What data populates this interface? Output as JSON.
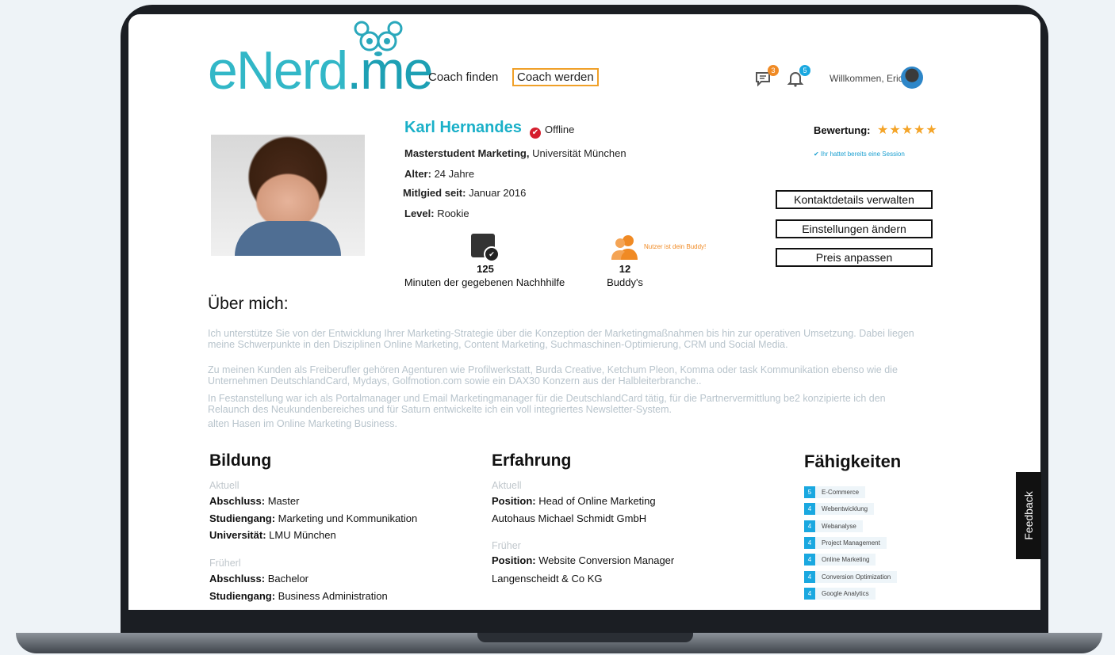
{
  "header": {
    "logo_main": "eNerd",
    "logo_dot": ".me",
    "nav_find": "Coach finden",
    "nav_become": "Coach werden",
    "messages_badge": "3",
    "notifications_badge": "5",
    "welcome": "Willkommen, Eric"
  },
  "profile": {
    "name": "Karl Hernandes",
    "status": "Offline",
    "degree_bold": "Masterstudent Marketing,",
    "degree_rest": " Universität München",
    "age_label": "Alter:",
    "age_value": " 24 Jahre",
    "member_label": "Mitlgied seit:",
    "member_value": " Januar 2016",
    "level_label": "Level:",
    "level_value": " Rookie",
    "stat_minutes_num": "125",
    "stat_minutes_label": "Minuten der gegebenen Nachhhilfe",
    "stat_buddies_num": "12",
    "stat_buddies_label": "Buddy's",
    "buddy_note": "Nutzer ist dein Buddy!",
    "rating_label": "Bewertung:",
    "rating_stars": 5,
    "session_note": "✔ Ihr hattet bereits eine Session",
    "btn_contact": "Kontaktdetails verwalten",
    "btn_settings": "Einstellungen ändern",
    "btn_price": "Preis anpassen"
  },
  "about": {
    "heading": "Über mich:",
    "p1": "Ich unterstütze Sie von der Entwicklung Ihrer Marketing-Strategie über die Konzeption der Marketingmaßnahmen bis hin zur operativen Umsetzung. Dabei liegen meine Schwerpunkte in den Disziplinen Online Marketing, Content Marketing, Suchmaschinen-Optimierung, CRM und Social Media.",
    "p2": "Zu meinen Kunden als Freiberufler gehören Agenturen wie Profilwerkstatt, Burda Creative, Ketchum Pleon, Komma oder task Kommunikation ebenso wie die Unternehmen DeutschlandCard, Mydays, Golfmotion.com sowie ein DAX30 Konzern aus der Halbleiterbranche..",
    "p3": "In Festanstellung war ich als Portalmanager und Email Marketingmanager für die DeutschlandCard tätig, für die Partnervermittlung be2 konzipierte ich den Relaunch des Neukundenbereiches und für Saturn entwickelte ich ein voll integriertes Newsletter-System.",
    "p4": "alten Hasen im Online Marketing Business."
  },
  "education": {
    "heading": "Bildung",
    "current_label": "Aktuell",
    "c_degree_label": "Abschluss:",
    "c_degree": " Master",
    "c_course_label": "Studiengang:",
    "c_course": " Marketing und Kommunikation",
    "c_uni_label": "Universität:",
    "c_uni": " LMU München",
    "prev_label": "Früherl",
    "p_degree_label": "Abschluss:",
    "p_degree": " Bachelor",
    "p_course_label": "Studiengang:",
    "p_course": " Business Administration"
  },
  "experience": {
    "heading": "Erfahrung",
    "current_label": "Aktuell",
    "c_pos_label": "Position:",
    "c_pos": " Head of Online Marketing",
    "c_company": "Autohaus Michael Schmidt GmbH",
    "prev_label": "Früher",
    "p_pos_label": "Position:",
    "p_pos": " Website Conversion Manager",
    "p_company": "Langenscheidt & Co KG"
  },
  "skills": {
    "heading": "Fähigkeiten",
    "items": [
      {
        "level": "5",
        "name": "E-Commerce"
      },
      {
        "level": "4",
        "name": "Webentwicklung"
      },
      {
        "level": "4",
        "name": "Webanalyse"
      },
      {
        "level": "4",
        "name": "Project Management"
      },
      {
        "level": "4",
        "name": "Online Marketing"
      },
      {
        "level": "4",
        "name": "Conversion Optimization"
      },
      {
        "level": "4",
        "name": "Google Analytics"
      }
    ]
  },
  "feedback_tab": "Feedback"
}
